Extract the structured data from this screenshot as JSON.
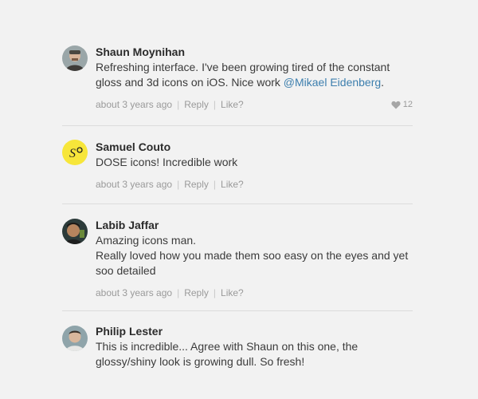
{
  "comments": [
    {
      "author": "Shaun Moynihan",
      "text_before_mention": "Refreshing interface. I've been growing tired of the constant gloss and 3d icons on iOS. Nice work ",
      "mention": "@Mikael Eidenberg",
      "text_after_mention": ".",
      "time": "about 3 years ago",
      "reply": "Reply",
      "like": "Like?",
      "like_count": "12"
    },
    {
      "author": "Samuel Couto",
      "lines": [
        "DOSE icons! Incredible work"
      ],
      "time": "about 3 years ago",
      "reply": "Reply",
      "like": "Like?"
    },
    {
      "author": "Labib Jaffar",
      "lines": [
        "Amazing icons man.",
        "Really loved how you made them soo easy on the eyes and yet soo detailed"
      ],
      "time": "about 3 years ago",
      "reply": "Reply",
      "like": "Like?"
    },
    {
      "author": "Philip Lester",
      "lines": [
        "This is incredible... Agree with Shaun on this one, the glossy/shiny look is growing dull. So fresh!"
      ]
    }
  ],
  "separator": "|",
  "colors": {
    "background": "#f2f2f2",
    "mention": "#3d7fae",
    "meta": "#9a9a9a",
    "divider": "#dcdcdc",
    "avatar_yellow": "#f7e63a"
  },
  "avatar_logo_text": "S",
  "icons": {
    "like": "heart-icon"
  }
}
